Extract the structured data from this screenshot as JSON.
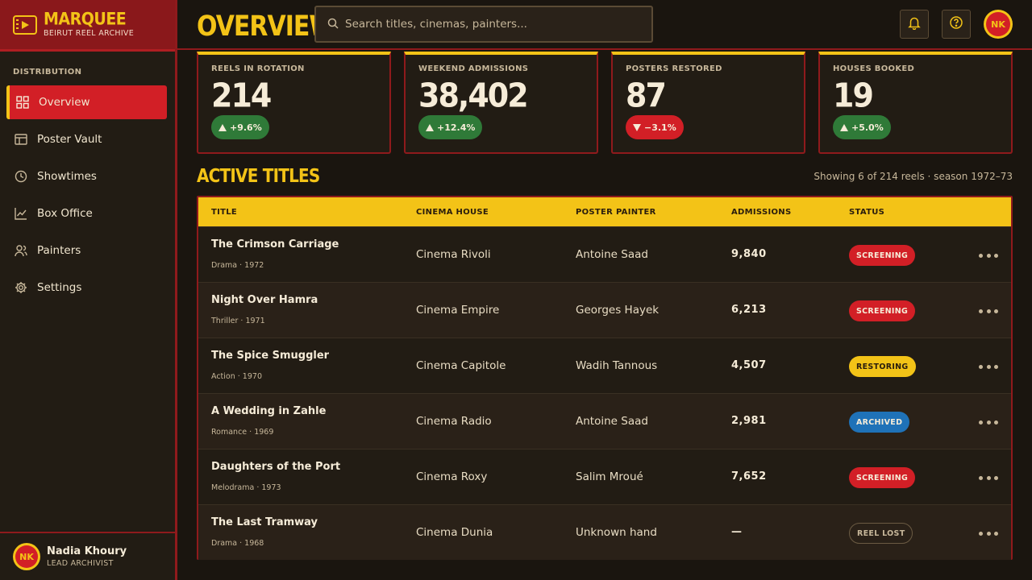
{
  "brand": {
    "name": "MARQUEE",
    "subtitle": "BEIRUT REEL ARCHIVE"
  },
  "sidebar": {
    "section": "DISTRIBUTION",
    "items": [
      {
        "label": "Overview",
        "icon": "grid-icon",
        "active": true
      },
      {
        "label": "Poster Vault",
        "icon": "layout-icon"
      },
      {
        "label": "Showtimes",
        "icon": "clock-icon"
      },
      {
        "label": "Box Office",
        "icon": "chart-icon"
      },
      {
        "label": "Painters",
        "icon": "users-icon"
      },
      {
        "label": "Settings",
        "icon": "gear-icon"
      }
    ]
  },
  "user": {
    "initials": "NK",
    "name": "Nadia Khoury",
    "role": "LEAD ARCHIVIST"
  },
  "header": {
    "title": "OVERVIEW",
    "search_placeholder": "Search titles, cinemas, painters..."
  },
  "kpis": [
    {
      "label": "REELS IN ROTATION",
      "value": "214",
      "delta": "+9.6%",
      "trend": "up"
    },
    {
      "label": "WEEKEND ADMISSIONS",
      "value": "38,402",
      "delta": "+12.4%",
      "trend": "up"
    },
    {
      "label": "POSTERS RESTORED",
      "value": "87",
      "delta": "−3.1%",
      "trend": "down"
    },
    {
      "label": "HOUSES BOOKED",
      "value": "19",
      "delta": "+5.0%",
      "trend": "up"
    }
  ],
  "section": {
    "title": "ACTIVE TITLES",
    "showing": "Showing 6 of 214 reels · season 1972–73"
  },
  "table": {
    "columns": [
      "TITLE",
      "CINEMA HOUSE",
      "POSTER PAINTER",
      "ADMISSIONS",
      "STATUS"
    ],
    "rows": [
      {
        "title": "The Crimson Carriage",
        "meta": "Drama · 1972",
        "cinema": "Cinema Rivoli",
        "painter": "Antoine Saad",
        "admissions": "9,840",
        "status": "SCREENING"
      },
      {
        "title": "Night Over Hamra",
        "meta": "Thriller · 1971",
        "cinema": "Cinema Empire",
        "painter": "Georges Hayek",
        "admissions": "6,213",
        "status": "SCREENING"
      },
      {
        "title": "The Spice Smuggler",
        "meta": "Action · 1970",
        "cinema": "Cinema Capitole",
        "painter": "Wadih Tannous",
        "admissions": "4,507",
        "status": "RESTORING"
      },
      {
        "title": "A Wedding in Zahle",
        "meta": "Romance · 1969",
        "cinema": "Cinema Radio",
        "painter": "Antoine Saad",
        "admissions": "2,981",
        "status": "ARCHIVED"
      },
      {
        "title": "Daughters of the Port",
        "meta": "Melodrama · 1973",
        "cinema": "Cinema Roxy",
        "painter": "Salim Mroué",
        "admissions": "7,652",
        "status": "SCREENING"
      },
      {
        "title": "The Last Tramway",
        "meta": "Drama · 1968",
        "cinema": "Cinema Dunia",
        "painter": "Unknown hand",
        "admissions": "—",
        "status": "REEL LOST"
      }
    ]
  },
  "colors": {
    "accent": "#f3c317",
    "brand_red": "#d21f26",
    "up": "#2f7a38",
    "archived": "#1f72b8"
  }
}
